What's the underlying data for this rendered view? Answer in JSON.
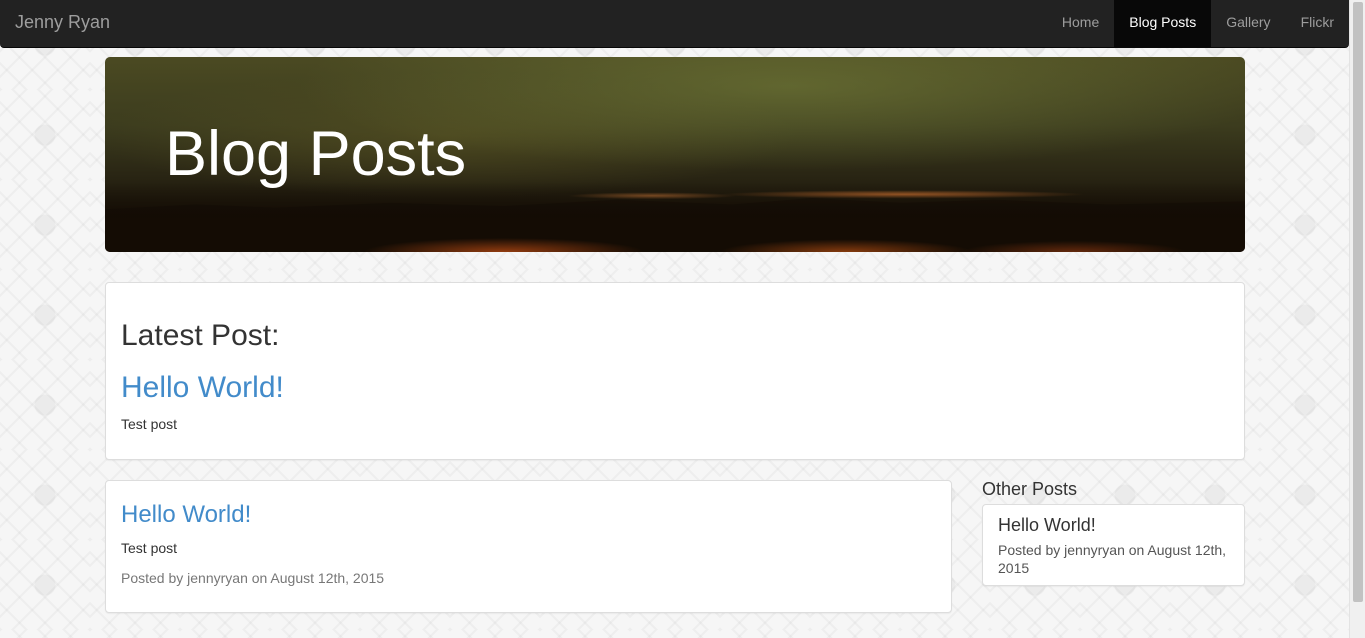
{
  "navbar": {
    "brand": "Jenny Ryan",
    "links": [
      {
        "label": "Home"
      },
      {
        "label": "Blog Posts"
      },
      {
        "label": "Gallery"
      },
      {
        "label": "Flickr"
      }
    ],
    "active": "Blog Posts"
  },
  "hero": {
    "title": "Blog Posts"
  },
  "latest": {
    "heading": "Latest Post:",
    "title": "Hello World!",
    "body": "Test post"
  },
  "posts": [
    {
      "title": "Hello World!",
      "body": "Test post",
      "meta": "Posted by jennyryan on August 12th, 2015"
    }
  ],
  "sidebar": {
    "heading": "Other Posts",
    "items": [
      {
        "title": "Hello World!",
        "meta": "Posted by jennyryan on August 12th, 2015"
      }
    ]
  },
  "colors": {
    "navbar_bg": "#222222",
    "link": "#428bca",
    "active_bg": "#080808"
  }
}
